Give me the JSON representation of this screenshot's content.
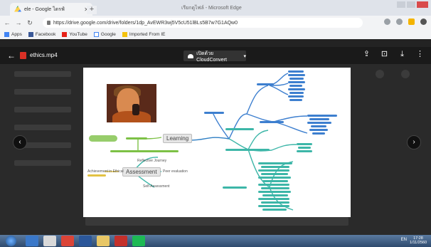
{
  "browser": {
    "tab_title": "ele - Google ไดรฟ์",
    "new_tab": "+",
    "window_title": "เรียกดูไฟล์ - Microsoft Edge",
    "url": "https://drive.google.com/drive/folders/1dp_AvEWR3wj5V5cU51lBLs5B7w7G1AQw0",
    "bookmarks": [
      "Apps",
      "Facebook",
      "YouTube",
      "Google",
      "Imported From IE"
    ]
  },
  "viewer": {
    "back": "←",
    "filename": "ethics.mp4",
    "open_with": "เปิดด้วย CloudConvert",
    "tools": [
      "⇪",
      "⊡",
      "⤓",
      "⋮"
    ],
    "prev": "‹",
    "next": "›"
  },
  "mindmap": {
    "center": "Learning",
    "left_hub": "Assessment",
    "left_labels": [
      "Reflective Journey",
      "Peer evaluation",
      "Self-Assessment"
    ],
    "leaf_small": "Achievement in Ethical"
  },
  "taskbar": {
    "tray": "EN",
    "time": "17:28",
    "date": "1/11/2560"
  }
}
